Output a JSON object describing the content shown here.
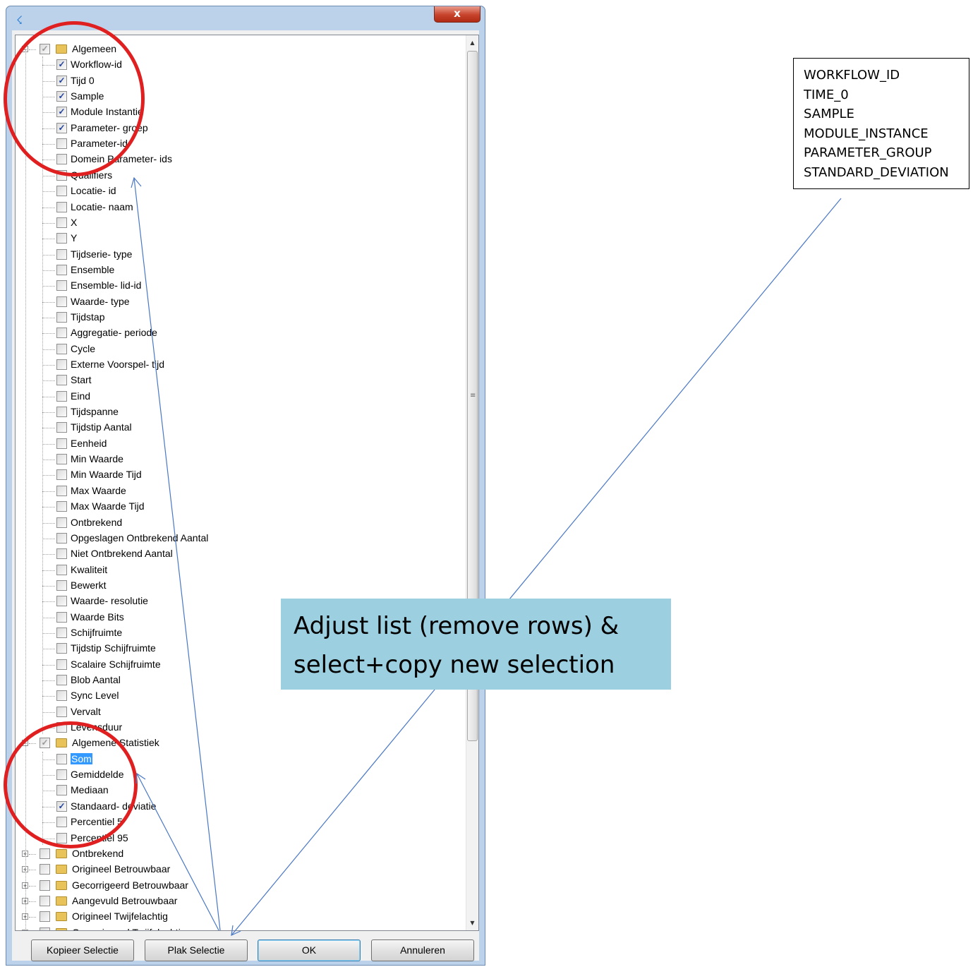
{
  "dialog": {
    "close_label": "x",
    "buttons": {
      "copy": "Kopieer Selectie",
      "paste": "Plak Selectie",
      "ok": "OK",
      "cancel": "Annuleren"
    }
  },
  "tree": [
    {
      "label": "Algemeen",
      "level": 0,
      "folder": true,
      "expander": "minus",
      "check": "grey"
    },
    {
      "label": "Workflow-id",
      "level": 1,
      "check": "checked"
    },
    {
      "label": "Tijd 0",
      "level": 1,
      "check": "checked"
    },
    {
      "label": "Sample",
      "level": 1,
      "check": "checked"
    },
    {
      "label": "Module Instantie",
      "level": 1,
      "check": "checked"
    },
    {
      "label": "Parameter- groep",
      "level": 1,
      "check": "checked"
    },
    {
      "label": "Parameter-id",
      "level": 1,
      "check": "none"
    },
    {
      "label": "Domein Parameter- ids",
      "level": 1,
      "check": "none"
    },
    {
      "label": "Qualifiers",
      "level": 1,
      "check": "none"
    },
    {
      "label": "Locatie- id",
      "level": 1,
      "check": "none"
    },
    {
      "label": "Locatie- naam",
      "level": 1,
      "check": "none"
    },
    {
      "label": "X",
      "level": 1,
      "check": "none"
    },
    {
      "label": "Y",
      "level": 1,
      "check": "none"
    },
    {
      "label": "Tijdserie- type",
      "level": 1,
      "check": "none"
    },
    {
      "label": "Ensemble",
      "level": 1,
      "check": "none"
    },
    {
      "label": "Ensemble- lid-id",
      "level": 1,
      "check": "none"
    },
    {
      "label": "Waarde- type",
      "level": 1,
      "check": "none"
    },
    {
      "label": "Tijdstap",
      "level": 1,
      "check": "none"
    },
    {
      "label": "Aggregatie- periode",
      "level": 1,
      "check": "none"
    },
    {
      "label": "Cycle",
      "level": 1,
      "check": "none"
    },
    {
      "label": "Externe Voorspel- tijd",
      "level": 1,
      "check": "none"
    },
    {
      "label": "Start",
      "level": 1,
      "check": "none"
    },
    {
      "label": "Eind",
      "level": 1,
      "check": "none"
    },
    {
      "label": "Tijdspanne",
      "level": 1,
      "check": "none"
    },
    {
      "label": "Tijdstip Aantal",
      "level": 1,
      "check": "none"
    },
    {
      "label": "Eenheid",
      "level": 1,
      "check": "none"
    },
    {
      "label": "Min Waarde",
      "level": 1,
      "check": "none"
    },
    {
      "label": "Min Waarde Tijd",
      "level": 1,
      "check": "none"
    },
    {
      "label": "Max Waarde",
      "level": 1,
      "check": "none"
    },
    {
      "label": "Max Waarde Tijd",
      "level": 1,
      "check": "none"
    },
    {
      "label": "Ontbrekend",
      "level": 1,
      "check": "none"
    },
    {
      "label": "Opgeslagen Ontbrekend Aantal",
      "level": 1,
      "check": "none"
    },
    {
      "label": "Niet Ontbrekend Aantal",
      "level": 1,
      "check": "none"
    },
    {
      "label": "Kwaliteit",
      "level": 1,
      "check": "none"
    },
    {
      "label": "Bewerkt",
      "level": 1,
      "check": "none"
    },
    {
      "label": "Waarde- resolutie",
      "level": 1,
      "check": "none"
    },
    {
      "label": "Waarde Bits",
      "level": 1,
      "check": "none"
    },
    {
      "label": "Schijfruimte",
      "level": 1,
      "check": "none"
    },
    {
      "label": "Tijdstip  Schijfruimte",
      "level": 1,
      "check": "none"
    },
    {
      "label": "Scalaire Schijfruimte",
      "level": 1,
      "check": "none"
    },
    {
      "label": "Blob Aantal",
      "level": 1,
      "check": "none"
    },
    {
      "label": "Sync Level",
      "level": 1,
      "check": "none"
    },
    {
      "label": "Vervalt",
      "level": 1,
      "check": "none"
    },
    {
      "label": "Levensduur",
      "level": 1,
      "check": "none"
    },
    {
      "label": "Algemene Statistiek",
      "level": 0,
      "folder": true,
      "expander": "minus",
      "check": "grey"
    },
    {
      "label": "Som",
      "level": 1,
      "check": "none",
      "selected": true
    },
    {
      "label": "Gemiddelde",
      "level": 1,
      "check": "none"
    },
    {
      "label": "Mediaan",
      "level": 1,
      "check": "none"
    },
    {
      "label": "Standaard- deviatie",
      "level": 1,
      "check": "checked"
    },
    {
      "label": "Percentiel 5",
      "level": 1,
      "check": "none"
    },
    {
      "label": "Percentiel 95",
      "level": 1,
      "check": "none"
    },
    {
      "label": "Ontbrekend",
      "level": 0,
      "folder": true,
      "expander": "plus",
      "check": "none"
    },
    {
      "label": "Origineel Betrouwbaar",
      "level": 0,
      "folder": true,
      "expander": "plus",
      "check": "none"
    },
    {
      "label": "Gecorrigeerd Betrouwbaar",
      "level": 0,
      "folder": true,
      "expander": "plus",
      "check": "none"
    },
    {
      "label": "Aangevuld Betrouwbaar",
      "level": 0,
      "folder": true,
      "expander": "plus",
      "check": "none"
    },
    {
      "label": "Origineel Twijfelachtig",
      "level": 0,
      "folder": true,
      "expander": "plus",
      "check": "none"
    },
    {
      "label": "Gecorrigeerd Twijfelachtig",
      "level": 0,
      "folder": true,
      "expander": "plus",
      "check": "none"
    }
  ],
  "note_box": {
    "lines": [
      "WORKFLOW_ID",
      "TIME_0",
      "SAMPLE",
      "MODULE_INSTANCE",
      "PARAMETER_GROUP",
      "STANDARD_DEVIATION"
    ]
  },
  "callout": {
    "line1": "Adjust list (remove rows) &",
    "line2": "select+copy new selection"
  },
  "colors": {
    "annotation_circle": "#e02020",
    "callout_bg": "#9ccfe0",
    "arrow": "#4a78c4",
    "selection": "#3399ff"
  }
}
